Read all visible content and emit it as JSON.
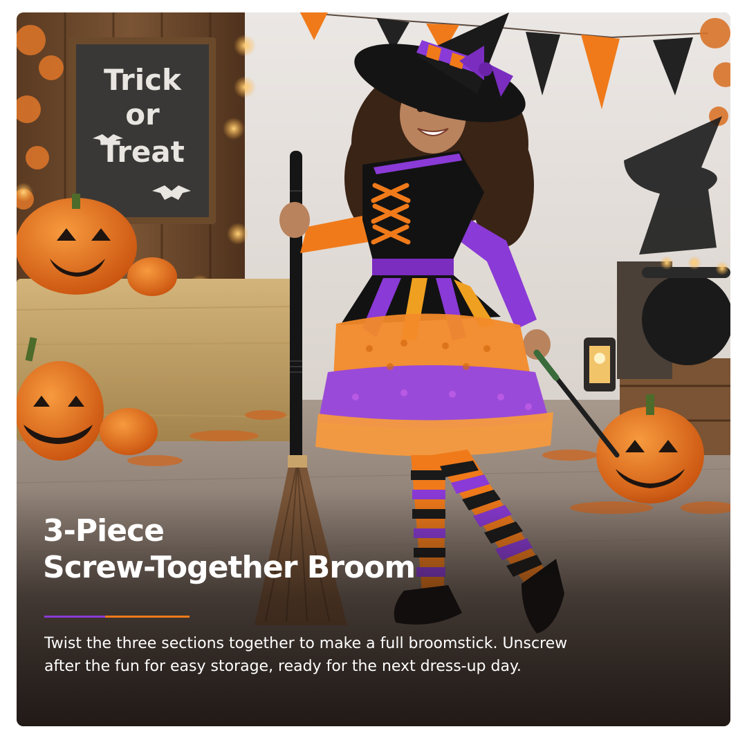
{
  "image": {
    "subject": "child-in-witch-costume-with-broom",
    "colors": {
      "accent_purple": "#8a3ad6",
      "accent_orange": "#f07a1a",
      "pumpkin": "#e8701f",
      "wall": "#e6e2df",
      "floor": "#8e8076"
    }
  },
  "chalkboard": {
    "lines": [
      "Trick",
      "or",
      "Treat"
    ]
  },
  "headline": {
    "line1": "3-Piece",
    "line2": "Screw-Together Broom"
  },
  "description": "Twist the three sections together to make a full broomstick. Unscrew after the fun for easy storage, ready for the next dress-up day."
}
